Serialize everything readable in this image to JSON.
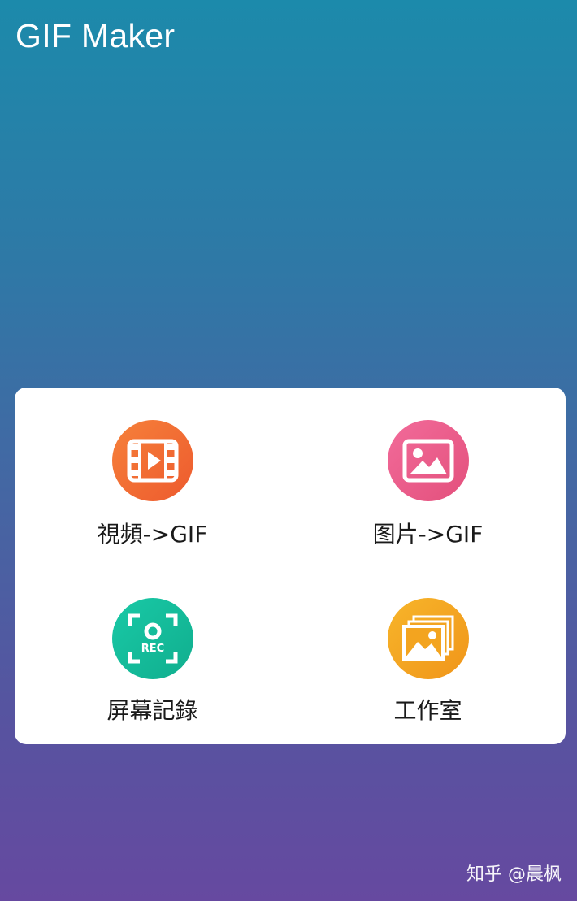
{
  "app": {
    "title": "GIF Maker"
  },
  "menu": {
    "items": [
      {
        "label": "視頻->GIF",
        "icon": "video-film-icon",
        "color": "#f26b33"
      },
      {
        "label": "图片->GIF",
        "icon": "image-picture-icon",
        "color": "#ea5d8a"
      },
      {
        "label": "屏幕記錄",
        "icon": "screen-record-icon",
        "color": "#14bc9b"
      },
      {
        "label": "工作室",
        "icon": "studio-gallery-icon",
        "color": "#f3a41f"
      }
    ]
  },
  "watermark": {
    "text": "知乎 @晨枫"
  },
  "colors": {
    "background_top": "#1c8aab",
    "background_bottom": "#6649a0",
    "card": "#ffffff"
  }
}
